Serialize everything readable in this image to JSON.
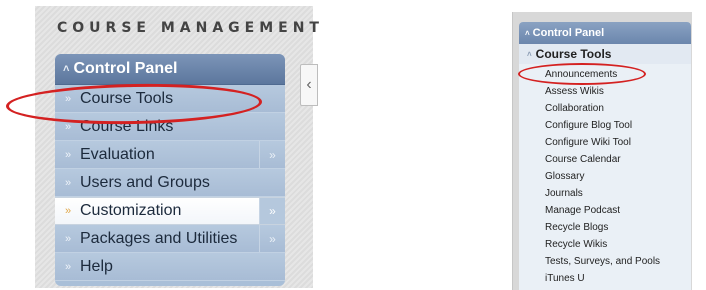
{
  "left": {
    "section_title": "COURSE MANAGEMENT",
    "collapse_glyph": "‹",
    "panel_title": "Control Panel",
    "items": [
      {
        "label": "Course Tools",
        "has_submenu": false,
        "active": false
      },
      {
        "label": "Course Links",
        "has_submenu": false,
        "active": false
      },
      {
        "label": "Evaluation",
        "has_submenu": true,
        "active": false
      },
      {
        "label": "Users and Groups",
        "has_submenu": false,
        "active": false
      },
      {
        "label": "Customization",
        "has_submenu": true,
        "active": true
      },
      {
        "label": "Packages and Utilities",
        "has_submenu": true,
        "active": false
      },
      {
        "label": "Help",
        "has_submenu": false,
        "active": false
      }
    ]
  },
  "right": {
    "panel_title": "Control Panel",
    "section_title": "Course Tools",
    "links": [
      "Announcements",
      "Assess Wikis",
      "Collaboration",
      "Configure Blog Tool",
      "Configure Wiki Tool",
      "Course Calendar",
      "Glossary",
      "Journals",
      "Manage Podcast",
      "Recycle Blogs",
      "Recycle Wikis",
      "Tests, Surveys, and Pools",
      "iTunes U"
    ]
  },
  "colors": {
    "highlight_oval": "#d42121",
    "panel_header": "#5c779d",
    "panel_body": "#a9bfd8"
  }
}
